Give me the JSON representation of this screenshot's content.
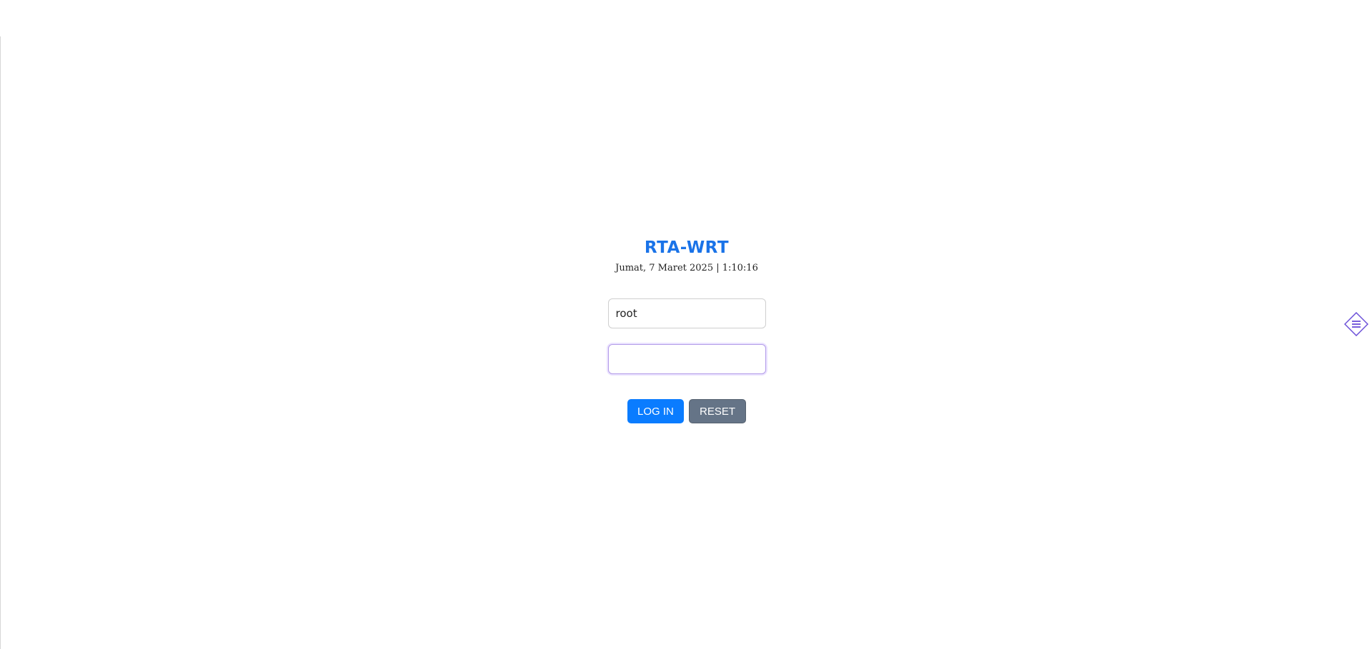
{
  "header": {
    "title": "RTA-WRT",
    "datetime": "Jumat, 7 Maret 2025 | 1:10:16"
  },
  "form": {
    "username_value": "root",
    "password_value": ""
  },
  "buttons": {
    "login_label": "LOG IN",
    "reset_label": "RESET"
  },
  "icons": {
    "menu": "menu-diamond-icon"
  },
  "colors": {
    "title": "#1a73e8",
    "login_button": "#0a7cff",
    "reset_button": "#657487",
    "menu_icon": "#6b4fd8"
  }
}
